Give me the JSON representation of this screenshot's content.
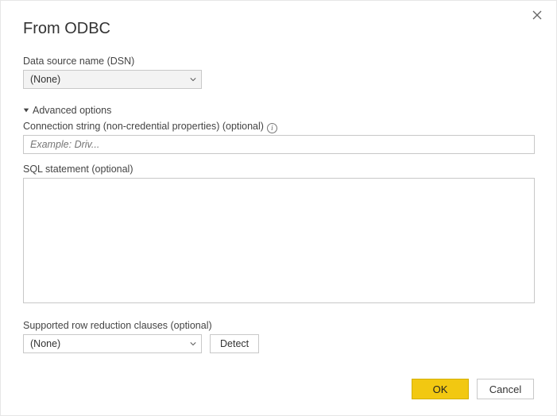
{
  "dialog": {
    "title": "From ODBC",
    "dsn": {
      "label": "Data source name (DSN)",
      "value": "(None)"
    },
    "advanced": {
      "toggle_label": "Advanced options",
      "conn_label": "Connection string (non-credential properties) (optional)",
      "conn_placeholder": "Example: Driv...",
      "sql_label": "SQL statement (optional)",
      "sql_value": "",
      "row_reduction_label": "Supported row reduction clauses (optional)",
      "row_reduction_value": "(None)",
      "detect_label": "Detect"
    },
    "buttons": {
      "ok": "OK",
      "cancel": "Cancel"
    },
    "info_glyph": "i"
  }
}
